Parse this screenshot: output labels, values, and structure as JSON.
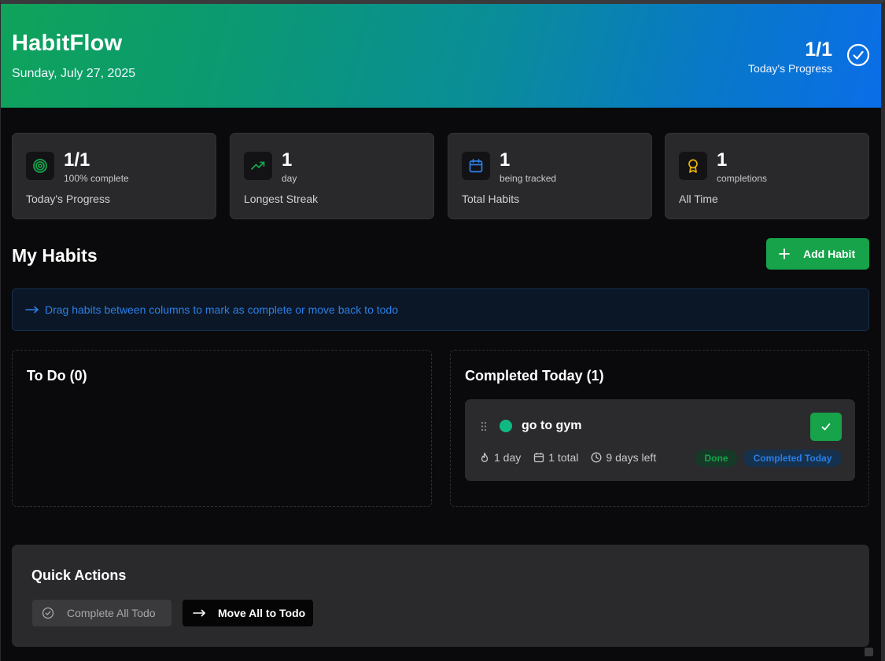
{
  "header": {
    "title": "HabitFlow",
    "date": "Sunday, July 27, 2025",
    "progress_value": "1/1",
    "progress_label": "Today's Progress"
  },
  "stats": [
    {
      "value": "1/1",
      "sub": "100% complete",
      "label": "Today's Progress",
      "icon": "target-icon",
      "icon_color": "#16a34a"
    },
    {
      "value": "1",
      "sub": "day",
      "label": "Longest Streak",
      "icon": "trending-up-icon",
      "icon_color": "#16a34a"
    },
    {
      "value": "1",
      "sub": "being tracked",
      "label": "Total Habits",
      "icon": "calendar-icon",
      "icon_color": "#2b7fe6"
    },
    {
      "value": "1",
      "sub": "completions",
      "label": "All Time",
      "icon": "award-icon",
      "icon_color": "#eab308"
    }
  ],
  "habits_section": {
    "title": "My Habits",
    "add_label": "Add Habit",
    "hint": "Drag habits between columns to mark as complete or move back to todo"
  },
  "columns": {
    "todo": {
      "title": "To Do (0)"
    },
    "done": {
      "title": "Completed Today (1)"
    }
  },
  "habit": {
    "name": "go to gym",
    "streak": "1 day",
    "total": "1 total",
    "days_left": "9 days left",
    "badge_done": "Done",
    "badge_today": "Completed Today",
    "dot_color": "#10b981"
  },
  "quick_actions": {
    "title": "Quick Actions",
    "complete_all": "Complete All Todo",
    "move_all": "Move All to Todo"
  },
  "colors": {
    "accent_green": "#16a34a",
    "accent_blue": "#2b7fe6",
    "background": "#0a0a0c",
    "card": "#29292c"
  }
}
